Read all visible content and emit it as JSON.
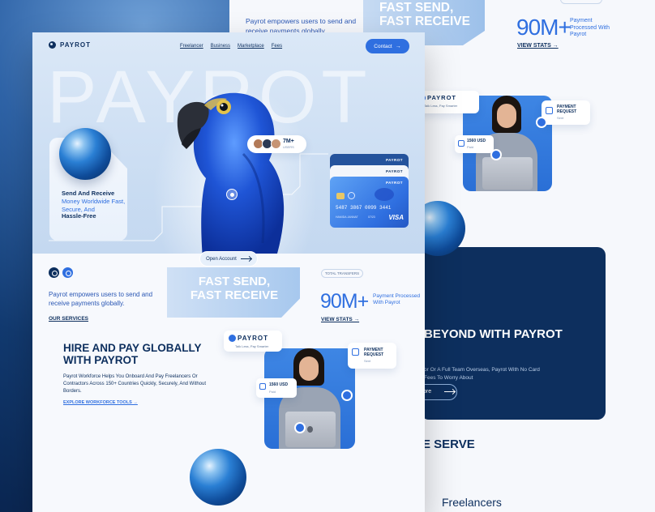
{
  "back_page": {
    "tagline": "Payrot empowers users to send and receive payments globally.",
    "hero_text": "FAST SEND, FAST RECEIVE",
    "stat_value": "90M+",
    "stat_caption": "Payment Processed With Payrot",
    "view_stats": "VIEW STATS →",
    "beyond_title": "BEYOND WITH PAYROT",
    "beyond_text": "or Or A Full Team Overseas, Payrot With No Card Fees To Worry About",
    "more_button": "ore",
    "serve_title": "E SERVE",
    "freelancers": "Freelancers",
    "logo_brand": "PAYROT",
    "logo_sub": "Talk Less, Pay Smarter",
    "payreq_title": "PAYMENT REQUEST",
    "payreq_sub": "Sent",
    "paid_value": "1560 USD",
    "paid_sub": "Paid"
  },
  "nav": {
    "brand": "PAYROT",
    "links": [
      "Freelancer",
      "Business",
      "Marketplace",
      "Fees"
    ],
    "contact": "Contact"
  },
  "hero": {
    "big_word": "PAYROT",
    "send_title": "Send And Receive",
    "send_line": "Money Worldwide Fast, Secure, And",
    "send_bold": "Hassle-Free",
    "users_value": "7M+",
    "users_caption": "USERS",
    "open_account": "Open Account",
    "fast_text": "FAST SEND, FAST RECEIVE",
    "tagline": "Payrot empowers users to send and receive payments globally.",
    "our_services": "OUR SERVICES",
    "total_transfers": "TOTAL TRANSFERS",
    "stat_value": "90M+",
    "stat_caption": "Payment Processed With Payrot",
    "view_stats": "VIEW STATS →"
  },
  "card": {
    "brand": "PAYROT",
    "number": "5487 3867 0099 3441",
    "holder": "HAMIDA JANNAT",
    "expiry": "07/23",
    "network": "VISA"
  },
  "workforce": {
    "title": "HIRE AND PAY GLOBALLY WITH PAYROT",
    "desc": "Payrot Workforce Helps You Onboard And Pay Freelancers Or Contractors Across 150+ Countries Quickly, Securely, And Without Borders.",
    "explore": "EXPLORE WORKFORCE TOOLS →",
    "logo_brand": "PAYROT",
    "logo_sub": "Talk Less, Pay Smarter",
    "payreq_title": "PAYMENT REQUEST",
    "payreq_sub": "Sent",
    "paid_value": "1560 USD",
    "paid_sub": "Paid"
  },
  "colors": {
    "primary": "#2f6fe0",
    "navy": "#0d2f5e",
    "light_bg": "#dbe8f7"
  }
}
